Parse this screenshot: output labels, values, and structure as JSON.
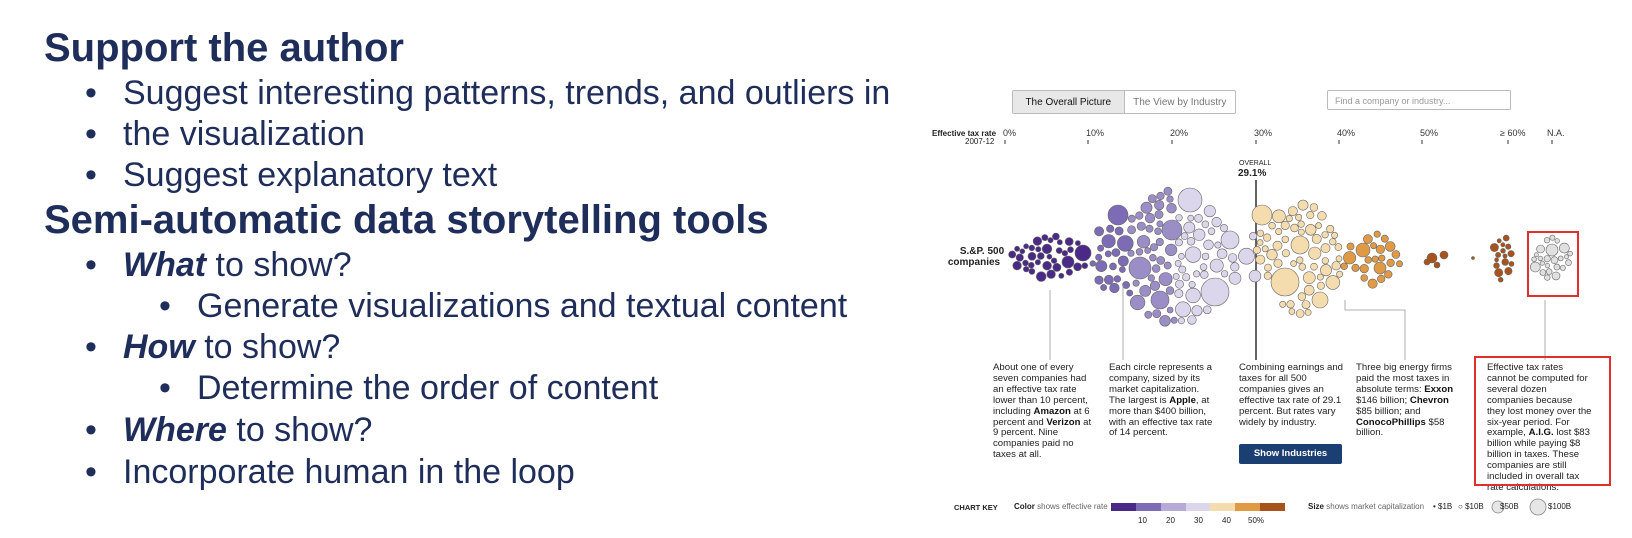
{
  "slide": {
    "heading1": "Support the author",
    "bullets1": [
      "Suggest interesting patterns, trends, and outliers in",
      "the visualization",
      "Suggest explanatory text"
    ],
    "heading2": "Semi-automatic data storytelling tools",
    "what_em": "What",
    "what_rest": " to show?",
    "what_sub": "Generate visualizations and textual content",
    "how_em": "How",
    "how_rest": " to show?",
    "how_sub": "Determine the order of content",
    "where_em": "Where",
    "where_rest": " to show?",
    "human": "Incorporate human in the loop"
  },
  "viz": {
    "tabs": [
      "The Overall Picture",
      "The View by Industry"
    ],
    "search_placeholder": "Find a company or industry...",
    "axis_label": "Effective tax rate",
    "axis_sub": "2007-12",
    "ticks": [
      "0%",
      "10%",
      "20%",
      "30%",
      "40%",
      "50%",
      "≥ 60%",
      "N.A."
    ],
    "overall_label": "OVERALL",
    "overall_value": "29.1%",
    "group_label_1": "S.&P. 500",
    "group_label_2": "companies",
    "annotations": {
      "a1": "About one of every seven companies had an effective tax rate lower than 10 percent, including",
      "a1_b1": "Amazon",
      "a1_mid": "at 6 percent and",
      "a1_b2": "Verizon",
      "a1_end": "at 9 percent. Nine companies paid no taxes at all.",
      "a2": "Each circle represents a company, sized by its market capitalization. The largest is",
      "a2_b": "Apple",
      "a2_end": ", at more than $400 billion, with an effective tax rate of 14 percent.",
      "a3": "Combining earnings and taxes for all 500 companies gives an effective tax rate of 29.1 percent. But rates vary widely by industry.",
      "a4": "Three big energy firms paid the most taxes in absolute terms:",
      "a4_b1": "Exxon",
      "a4_t1": "$146 billion;",
      "a4_b2": "Chevron",
      "a4_t2": "$85 billion; and",
      "a4_b3": "ConocoPhillips",
      "a4_t3": "$58 billion.",
      "a5": "Effective tax rates cannot be computed for several dozen companies because they lost money over the six-year period. For example,",
      "a5_b": "A.I.G.",
      "a5_end": "lost $83 billion while paying $8 billion in taxes. These companies are still included in overall tax rate calculations."
    },
    "show_button": "Show Industries",
    "key": {
      "title": "CHART KEY",
      "color_label": "Color",
      "color_sub": "shows effective rate",
      "color_ticks": [
        "10",
        "20",
        "30",
        "40",
        "50%"
      ],
      "size_label": "Size",
      "size_sub": "shows market capitalization",
      "size_items": [
        "$1B",
        "$10B",
        "$50B",
        "$100B"
      ]
    },
    "colors": {
      "purple_dark": "#4a2a86",
      "purple_mid": "#9b8dc6",
      "lavender": "#dcd6ec",
      "cream": "#f5dcae",
      "orange": "#e09a46",
      "brown": "#a8531b",
      "gray": "#e0e0e0",
      "highlight": "#e0302c"
    }
  }
}
